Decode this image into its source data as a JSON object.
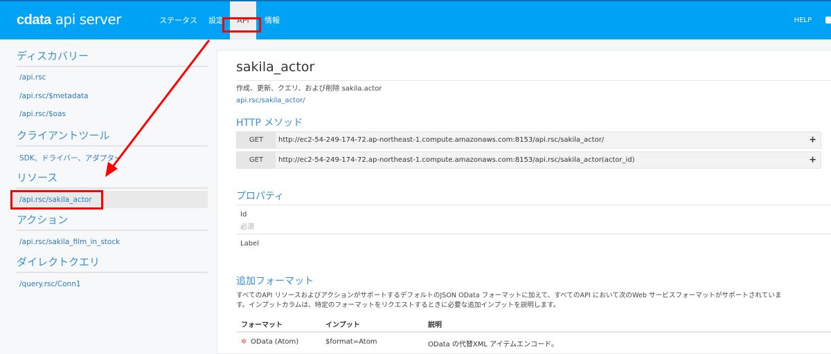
{
  "header": {
    "logo_brand": "cdata",
    "logo_product": "api server",
    "nav": [
      {
        "label": "ステータス"
      },
      {
        "label": "設定"
      },
      {
        "label": "API"
      },
      {
        "label": "情報"
      }
    ],
    "help": "HELP"
  },
  "sidebar": {
    "discovery": {
      "title": "ディスカバリー",
      "items": [
        "/api.rsc",
        "/api.rsc/$metadata",
        "/api.rsc/$oas"
      ]
    },
    "client_tools": {
      "title": "クライアントツール",
      "items": [
        "SDK、ドライバー、アダプター"
      ]
    },
    "resources": {
      "title": "リソース",
      "items": [
        "/api.rsc/sakila_actor"
      ]
    },
    "actions": {
      "title": "アクション",
      "items": [
        "/api.rsc/sakila_film_in_stock"
      ]
    },
    "direct_query": {
      "title": "ダイレクトクエリ",
      "items": [
        "/query.rsc/Conn1"
      ]
    }
  },
  "main": {
    "title": "sakila_actor",
    "description": "作成、更新、クエリ、および削除 sakila.actor",
    "path_link": "api.rsc/sakila_actor/",
    "http_title": "HTTP メソッド",
    "methods": [
      {
        "verb": "GET",
        "url": "http://ec2-54-249-174-72.ap-northeast-1.compute.amazonaws.com:8153/api.rsc/sakila_actor/"
      },
      {
        "verb": "GET",
        "url": "http://ec2-54-249-174-72.ap-northeast-1.compute.amazonaws.com:8153/api.rsc/sakila_actor(actor_id)"
      }
    ],
    "props_title": "プロパティ",
    "properties": [
      {
        "name": "Id",
        "note": "必須"
      },
      {
        "name": "Label"
      }
    ],
    "formats_title": "追加フォーマット",
    "formats_desc1": "すべてのAPI リソースおよびアクションがサポートするデフォルトのJSON OData フォーマットに加えて、すべてのAPI において次のWeb サービスフォーマットがサポートされていま",
    "formats_desc2": "す。インプットカラムは、特定のフォーマットをリクエストするときに必要な追加インプットを説明します。",
    "table": {
      "headers": [
        "フォーマット",
        "インプット",
        "説明"
      ],
      "rows": [
        [
          "OData (Atom)",
          "$format=Atom",
          "OData の代替XML アイテムエンコード。"
        ]
      ]
    }
  },
  "colors": {
    "header": "#00a2f5",
    "accent": "#3a8fd0",
    "annotation": "#ff0000"
  }
}
